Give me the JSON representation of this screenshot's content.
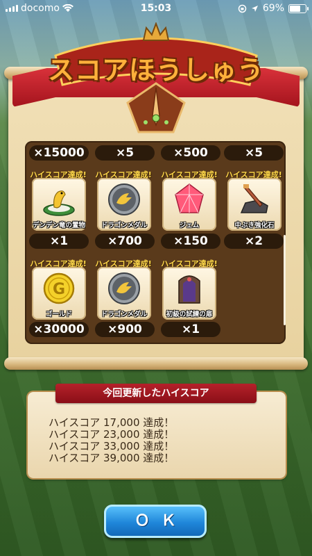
{
  "status_bar": {
    "carrier": "docomo",
    "time": "15:03",
    "battery": "69%"
  },
  "title": "スコアほうしゅう",
  "top_counts": [
    "×15000",
    "×5",
    "×500",
    "×5"
  ],
  "rows": [
    {
      "items": [
        {
          "badge": "ハイスコア達成!",
          "name": "デンデン竜の置物",
          "count": "×1",
          "icon": "dragon-figurine-icon"
        },
        {
          "badge": "ハイスコア達成!",
          "name": "ドラゴンメダル",
          "count": "×700",
          "icon": "dragon-medal-icon"
        },
        {
          "badge": "ハイスコア達成!",
          "name": "ジェム",
          "count": "×150",
          "icon": "gem-icon"
        },
        {
          "badge": "ハイスコア達成!",
          "name": "中ぶき強化石",
          "count": "×2",
          "icon": "weapon-stone-icon"
        }
      ]
    },
    {
      "items": [
        {
          "badge": "ハイスコア達成!",
          "name": "ゴールド",
          "count": "×30000",
          "icon": "gold-coin-icon"
        },
        {
          "badge": "ハイスコア達成!",
          "name": "ドラゴンメダル",
          "count": "×900",
          "icon": "dragon-medal-icon"
        },
        {
          "badge": "ハイスコア達成!",
          "name": "初級の試練の扉",
          "count": "×1",
          "icon": "trial-door-icon"
        }
      ]
    }
  ],
  "notice": {
    "header": "今回更新したハイスコア",
    "lines": [
      "ハイスコア 17,000 達成！",
      "ハイスコア 23,000 達成！",
      "ハイスコア 33,000 達成！",
      "ハイスコア 39,000 達成！"
    ]
  },
  "ok_button": "ＯＫ",
  "colors": {
    "banner_red": "#b5212a",
    "title_orange": "#ffb13b",
    "ok_blue": "#1f86d9"
  }
}
